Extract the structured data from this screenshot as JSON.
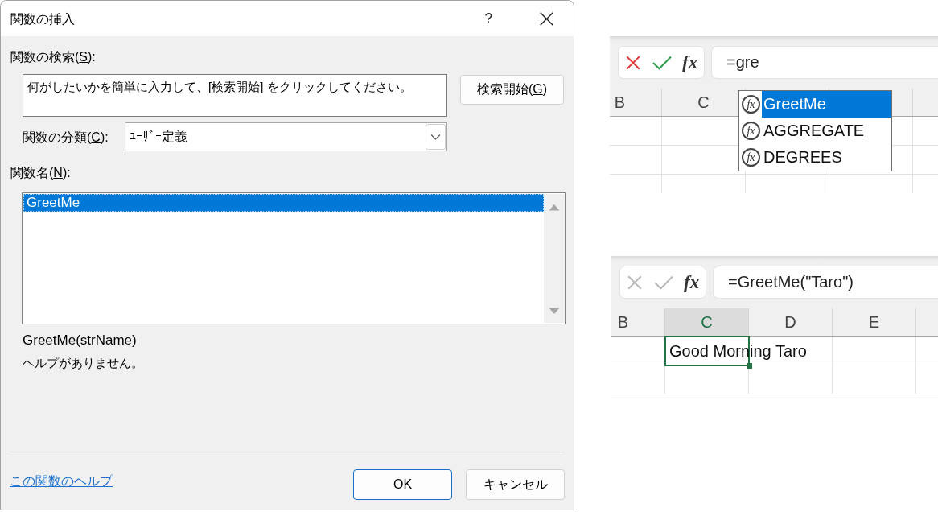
{
  "dialog": {
    "title": "関数の挿入",
    "help_button": "?",
    "search": {
      "label": "関数の検索(",
      "access_key": "S",
      "label_end": "):",
      "value": "何がしたいかを簡単に入力して、[検索開始] をクリックしてください。",
      "button": {
        "label": "検索開始(",
        "access_key": "G",
        "label_end": ")"
      }
    },
    "category": {
      "label": "関数の分類(",
      "access_key": "C",
      "label_end": "):",
      "value": "ﾕｰｻﾞｰ定義"
    },
    "function_list": {
      "label": "関数名(",
      "access_key": "N",
      "label_end": "):",
      "items": [
        {
          "name": "GreetMe",
          "selected": true
        }
      ]
    },
    "syntax": "GreetMe(strName)",
    "description": "ヘルプがありません。",
    "help_link": "この関数のヘルプ",
    "buttons": [
      {
        "label": "OK",
        "default": true
      },
      {
        "label": "キャンセル",
        "default": false
      }
    ]
  },
  "excel_views": [
    {
      "formula_bar": {
        "editing": true,
        "function_button": "fx",
        "formula": "=gre"
      },
      "columns": [
        {
          "label": "B",
          "selected": false
        },
        {
          "label": "C",
          "selected": false
        }
      ],
      "autocomplete": [
        {
          "icon_text": "fx",
          "name": "GreetMe",
          "selected": true
        },
        {
          "icon_text": "fx",
          "name": "AGGREGATE",
          "selected": false
        },
        {
          "icon_text": "fx",
          "name": "DEGREES",
          "selected": false
        }
      ]
    },
    {
      "formula_bar": {
        "editing": false,
        "function_button": "fx",
        "formula": "=GreetMe(\"Taro\")"
      },
      "columns": [
        {
          "label": "B",
          "selected": false
        },
        {
          "label": "C",
          "selected": true,
          "cells": [
            {
              "text": "Good Morning Taro",
              "selected": true
            }
          ]
        },
        {
          "label": "D",
          "selected": false
        },
        {
          "label": "E",
          "selected": false
        }
      ]
    }
  ]
}
